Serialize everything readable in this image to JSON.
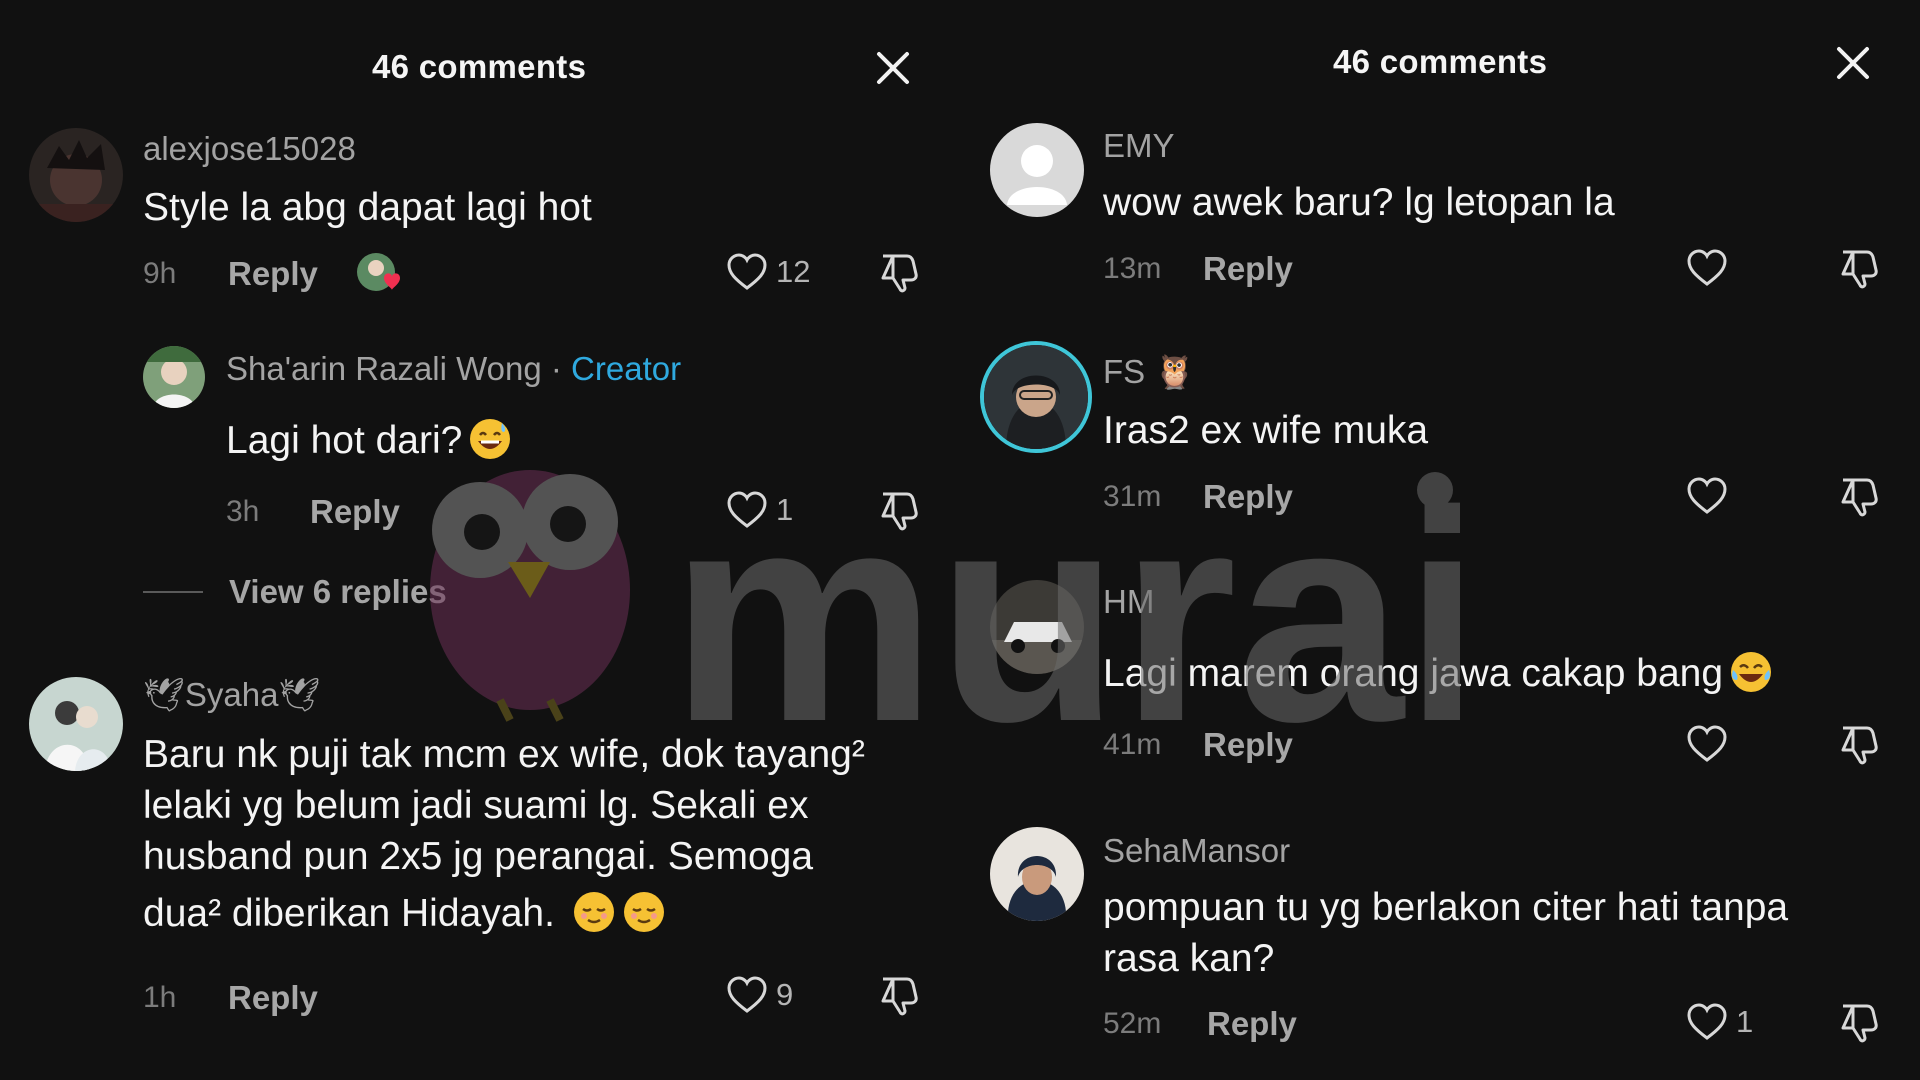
{
  "left": {
    "header_title": "46 comments",
    "comments": [
      {
        "user": "alexjose15028",
        "text": "Style la abg dapat lagi hot",
        "time": "9h",
        "reply": "Reply",
        "likes": "12"
      },
      {
        "user": "Sha'arin Razali Wong",
        "creator_sep": "·",
        "creator": "Creator",
        "text": "Lagi hot dari?",
        "time": "3h",
        "reply": "Reply",
        "likes": "1"
      },
      {
        "user": "Syaha",
        "text_lines": [
          "Baru nk puji tak mcm ex wife, dok tayang²",
          "lelaki yg belum jadi suami lg. Sekali ex",
          "husband pun 2x5 jg perangai. Semoga",
          "dua² diberikan Hidayah."
        ],
        "time": "1h",
        "reply": "Reply",
        "likes": "9"
      }
    ],
    "view_replies": "View 6 replies"
  },
  "right": {
    "header_title": "46 comments",
    "comments": [
      {
        "user": "EMY",
        "text": "wow awek baru? lg letopan la",
        "time": "13m",
        "reply": "Reply"
      },
      {
        "user": "FS",
        "text": "Iras2 ex wife muka",
        "time": "31m",
        "reply": "Reply"
      },
      {
        "user": "HM",
        "text": "Lagi marem orang jawa cakap bang",
        "time": "41m",
        "reply": "Reply"
      },
      {
        "user": "SehaMansor",
        "text_lines": [
          "pompuan tu yg berlakon citer hati tanpa",
          "rasa kan?"
        ],
        "time": "52m",
        "reply": "Reply",
        "likes": "1"
      }
    ]
  },
  "watermark_text": "murai",
  "icons": {
    "close": "close-icon",
    "like": "heart-icon",
    "dislike": "thumbs-down-icon",
    "sticker": "avatar-heart-sticker-icon",
    "emoji_sweat": "grinning-sweat-emoji-icon",
    "emoji_relieved": "relieved-face-emoji-icon",
    "emoji_laugh": "tears-of-joy-emoji-icon",
    "owl": "owl-emoji-icon",
    "dove": "dove-emoji-icon"
  },
  "colors": {
    "background": "#111111",
    "creator": "#2fa9df",
    "story_ring": "#3fc6d8"
  }
}
